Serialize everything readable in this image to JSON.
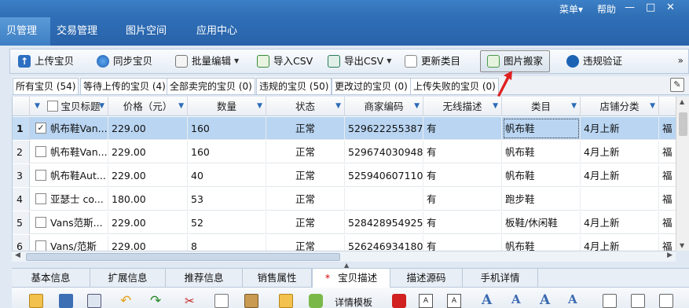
{
  "titlebar": {
    "menu_label": "菜单",
    "menu_arrow": "▾",
    "help_label": "帮助",
    "controls": [
      "—",
      "□",
      "✕"
    ]
  },
  "mainnav": {
    "tabs": [
      {
        "label": "贝管理",
        "active": true
      },
      {
        "label": "交易管理"
      },
      {
        "label": "图片空间"
      },
      {
        "label": "应用中心"
      }
    ]
  },
  "toolbar": {
    "items": [
      {
        "label": "上传宝贝",
        "icon": "upload-icon"
      },
      {
        "label": "同步宝贝",
        "icon": "sync-icon"
      },
      {
        "label": "批量编辑",
        "icon": "batch-edit-icon"
      },
      {
        "label": "导入CSV",
        "icon": "import-csv-icon"
      },
      {
        "label": "导出CSV",
        "icon": "export-csv-icon"
      },
      {
        "label": "更新类目",
        "icon": "update-category-icon"
      },
      {
        "label": "图片搬家",
        "icon": "image-move-icon"
      },
      {
        "label": "违规验证",
        "icon": "violation-check-icon"
      }
    ],
    "more": "»"
  },
  "filter_tabs": [
    "所有宝贝 (54)",
    "等待上传的宝贝 (4)",
    "全部卖完的宝贝 (0)",
    "违规的宝贝 (50)",
    "更改过的宝贝 (0)",
    "上传失败的宝贝 (0)"
  ],
  "grid": {
    "columns": [
      "宝贝标题",
      "价格（元）",
      "数量",
      "状态",
      "商家编码",
      "无线描述",
      "类目",
      "店铺分类"
    ],
    "rows": [
      {
        "n": "1",
        "checked": true,
        "title": "帆布鞋Van...",
        "price": "229.00",
        "qty": "160",
        "status": "正常",
        "code": "529622255387",
        "wireless": "有",
        "cat": "帆布鞋",
        "shop": "4月上新",
        "extra": "福"
      },
      {
        "n": "2",
        "checked": false,
        "title": "帆布鞋Van...",
        "price": "229.00",
        "qty": "160",
        "status": "正常",
        "code": "529674030948",
        "wireless": "有",
        "cat": "帆布鞋",
        "shop": "4月上新",
        "extra": "福"
      },
      {
        "n": "3",
        "checked": false,
        "title": "帆布鞋Aut...",
        "price": "229.00",
        "qty": "40",
        "status": "正常",
        "code": "525940607110",
        "wireless": "有",
        "cat": "帆布鞋",
        "shop": "4月上新",
        "extra": "福"
      },
      {
        "n": "4",
        "checked": false,
        "title": "亚瑟士 co...",
        "price": "180.00",
        "qty": "53",
        "status": "正常",
        "code": "",
        "wireless": "有",
        "cat": "跑步鞋",
        "shop": "",
        "extra": "福"
      },
      {
        "n": "5",
        "checked": false,
        "title": "Vans范斯...",
        "price": "229.00",
        "qty": "52",
        "status": "正常",
        "code": "528428954925",
        "wireless": "有",
        "cat": "板鞋/休闲鞋",
        "shop": "4月上新",
        "extra": "福"
      },
      {
        "n": "6",
        "checked": false,
        "title": "Vans/范斯",
        "price": "229.00",
        "qty": "8",
        "status": "正常",
        "code": "526246934180",
        "wireless": "有",
        "cat": "帆布鞋",
        "shop": "4月上新",
        "extra": "福"
      }
    ]
  },
  "bottom_tabs": [
    {
      "label": "基本信息"
    },
    {
      "label": "扩展信息"
    },
    {
      "label": "推荐信息"
    },
    {
      "label": "销售属性"
    },
    {
      "label": "宝贝描述",
      "active": true,
      "star": "*"
    },
    {
      "label": "描述源码"
    },
    {
      "label": "手机详情"
    }
  ],
  "editor_toolbar": {
    "template_label": "详情模板"
  },
  "colors": {
    "nav_blue": "#2962a8",
    "selected_row": "#b9d5f2",
    "filter_icon": "#2c6bb8",
    "arrow_red": "#e02020"
  }
}
